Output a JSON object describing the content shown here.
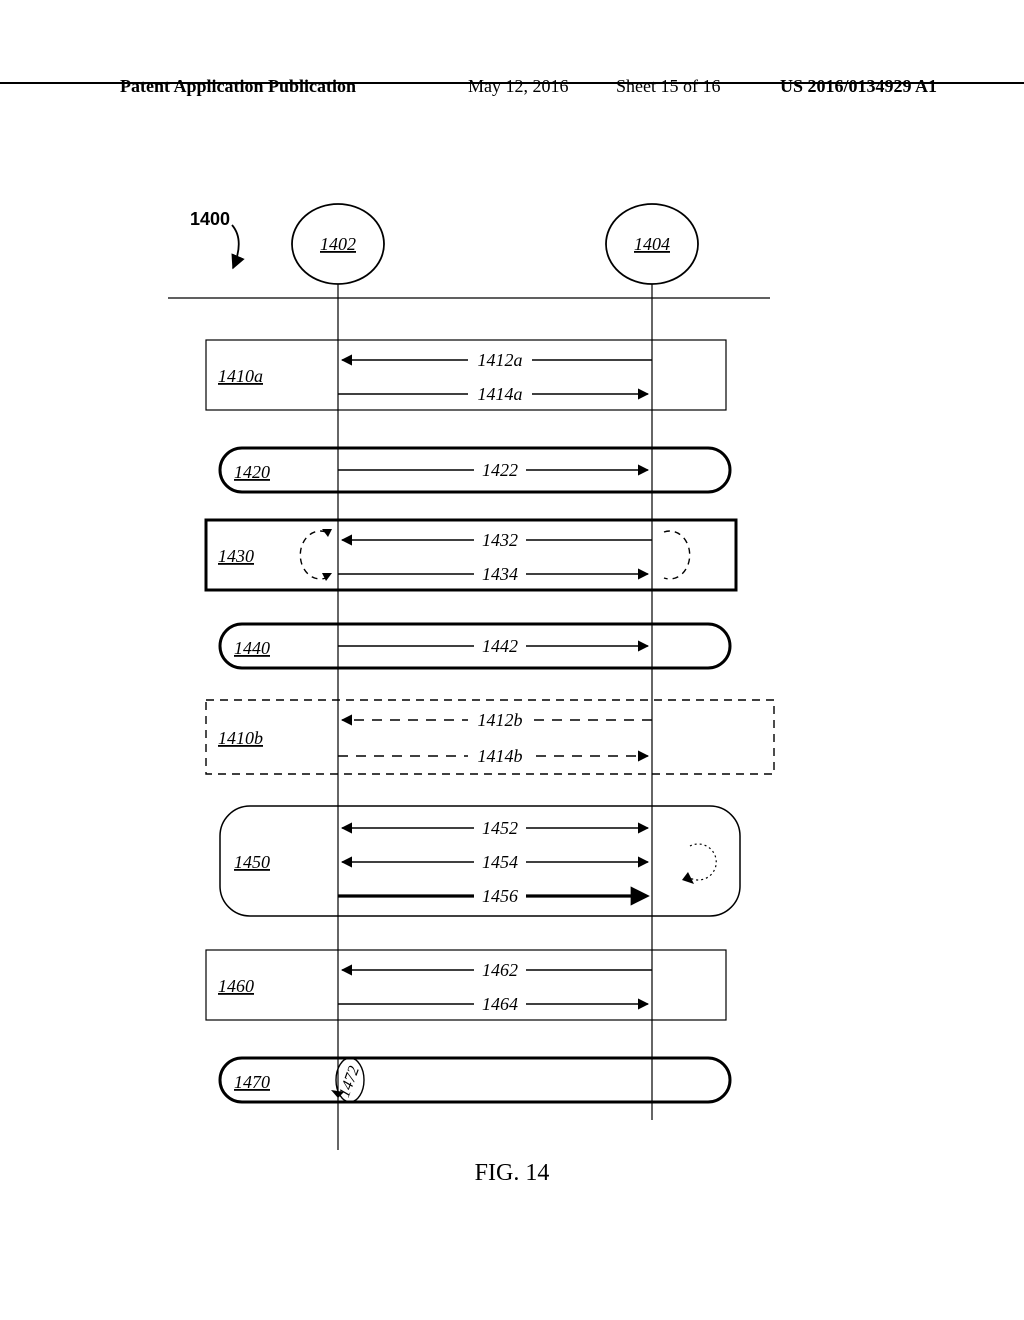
{
  "header": {
    "publication_type": "Patent Application Publication",
    "date": "May 12, 2016",
    "sheet": "Sheet 15 of 16",
    "pub_number": "US 2016/0134929 A1"
  },
  "figure": {
    "caption": "FIG. 14",
    "overall_ref": "1400",
    "entities": {
      "left": "1402",
      "right": "1404"
    },
    "blocks": {
      "b1410a": "1410a",
      "b1420": "1420",
      "b1430": "1430",
      "b1440": "1440",
      "b1410b": "1410b",
      "b1450": "1450",
      "b1460": "1460",
      "b1470": "1470"
    },
    "messages": {
      "m1412a": "1412a",
      "m1414a": "1414a",
      "m1422": "1422",
      "m1432": "1432",
      "m1434": "1434",
      "m1442": "1442",
      "m1412b": "1412b",
      "m1414b": "1414b",
      "m1452": "1452",
      "m1454": "1454",
      "m1456": "1456",
      "m1462": "1462",
      "m1464": "1464",
      "m1472": "1472"
    }
  }
}
